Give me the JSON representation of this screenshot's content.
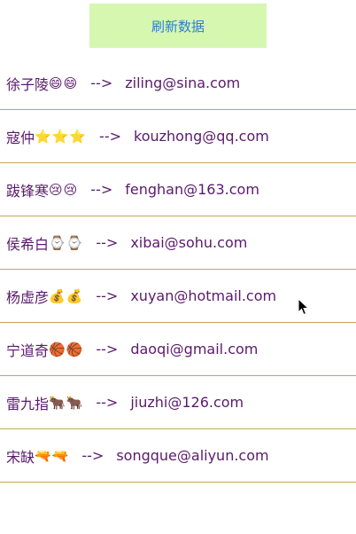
{
  "header": {
    "refresh_label": "刷新数据"
  },
  "rows": [
    {
      "name": "徐子陵",
      "emoji": "😄😄",
      "arrow": "-->",
      "email": "ziling@sina.com"
    },
    {
      "name": "寇仲",
      "emoji": "⭐⭐⭐",
      "arrow": "-->",
      "email": "kouzhong@qq.com"
    },
    {
      "name": "跋锋寒",
      "emoji": "😢😢",
      "arrow": "-->",
      "email": "fenghan@163.com"
    },
    {
      "name": "侯希白",
      "emoji": "⌚⌚",
      "arrow": "-->",
      "email": "xibai@sohu.com"
    },
    {
      "name": "杨虚彦",
      "emoji": "💰💰",
      "arrow": "-->",
      "email": "xuyan@hotmail.com"
    },
    {
      "name": "宁道奇",
      "emoji": "🏀🏀",
      "arrow": "-->",
      "email": "daoqi@gmail.com"
    },
    {
      "name": "雷九指",
      "emoji": "🐂🐂",
      "arrow": "-->",
      "email": "jiuzhi@126.com"
    },
    {
      "name": "宋缺",
      "emoji": "🔫🔫",
      "arrow": "-->",
      "email": "songque@aliyun.com"
    }
  ]
}
